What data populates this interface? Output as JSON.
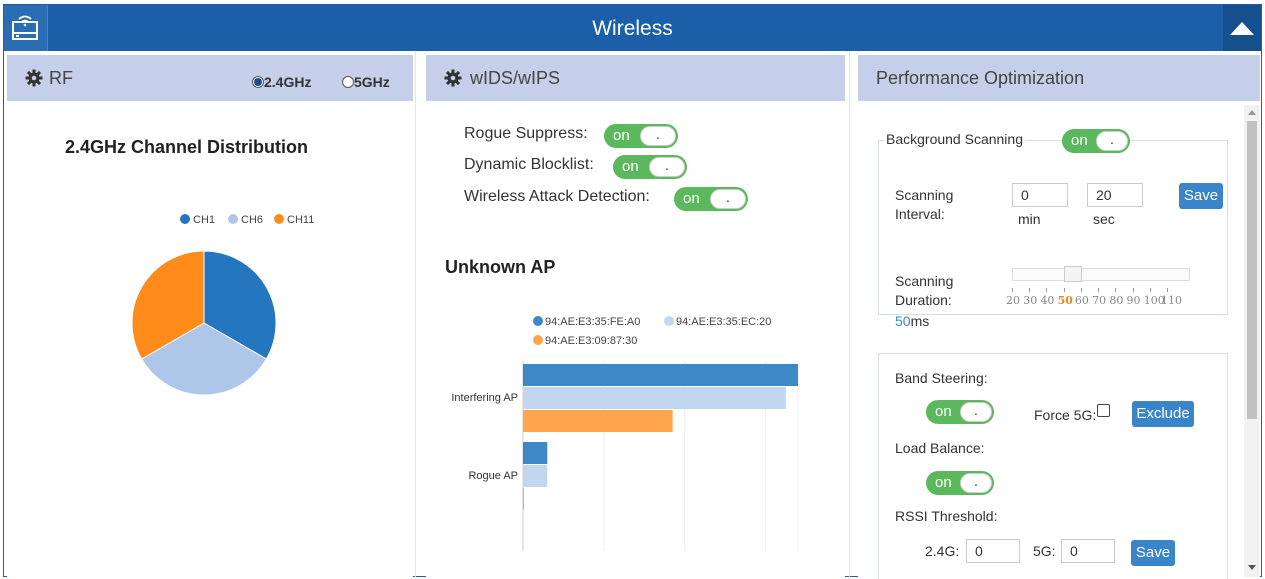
{
  "header": {
    "title": "Wireless",
    "left_icon": "router-icon",
    "right_icon": "caret-up-icon"
  },
  "rf": {
    "title": "RF",
    "band_options": [
      {
        "label": "2.4GHz",
        "selected": true
      },
      {
        "label": "5GHz",
        "selected": false
      }
    ],
    "chart_title": "2.4GHz Channel Distribution"
  },
  "wids": {
    "title": "wIDS/wIPS",
    "toggles": [
      {
        "label": "Rogue Suppress:",
        "state": "on",
        "knob": "."
      },
      {
        "label": "Dynamic Blocklist:",
        "state": "on",
        "knob": "."
      },
      {
        "label": "Wireless Attack Detection:",
        "state": "on",
        "knob": "."
      }
    ],
    "unknown_ap_title": "Unknown AP"
  },
  "perf": {
    "title": "Performance Optimization",
    "background_scanning": {
      "label": "Background Scanning",
      "state": "on",
      "knob": "."
    },
    "scanning_interval": {
      "label_line1": "Scanning",
      "label_line2": "Interval:",
      "min_value": "0",
      "min_unit": "min",
      "sec_value": "20",
      "sec_unit": "sec",
      "save": "Save"
    },
    "scanning_duration": {
      "label_line1": "Scanning",
      "label_line2": "Duration:",
      "value": "50",
      "unit": "ms",
      "level": 0.333,
      "ticks": [
        "20",
        "30",
        "40",
        "50",
        "60",
        "70",
        "80",
        "90",
        "100",
        "110"
      ],
      "selected_tick": "50"
    },
    "band_steering": {
      "label": "Band Steering:",
      "state": "on",
      "knob": ".",
      "force5g_label": "Force 5G:",
      "force5g_checked": false,
      "exclude": "Exclude"
    },
    "load_balance": {
      "label": "Load Balance:",
      "state": "on",
      "knob": "."
    },
    "rssi": {
      "label": "RSSI Threshold:",
      "g24_label": "2.4G:",
      "g24_value": "0",
      "g5_label": "5G:",
      "g5_value": "0",
      "save": "Save"
    }
  },
  "colors": {
    "header": "#1a5fa8",
    "panel_head": "#c5cfe9",
    "toggle_on": "#5cb85c",
    "button": "#3a85c9",
    "ch1": "#2477be",
    "ch6": "#aec7e8",
    "ch11": "#ff8c1a"
  },
  "chart_data": [
    {
      "type": "pie",
      "title": "2.4GHz Channel Distribution",
      "legend_position": "top",
      "categories": [
        "CH1",
        "CH6",
        "CH11"
      ],
      "values": [
        1,
        1,
        1
      ],
      "colors": [
        "#2477be",
        "#aec7e8",
        "#ff8c1a"
      ]
    },
    {
      "type": "bar",
      "orientation": "horizontal",
      "title": "Unknown AP",
      "legend_position": "top",
      "categories": [
        "Interfering AP",
        "Rogue AP"
      ],
      "series": [
        {
          "name": "94:AE:E3:35:FE:A0",
          "values": [
            68,
            6
          ],
          "color": "#3d88c6"
        },
        {
          "name": "94:AE:E3:35:EC:20",
          "values": [
            65,
            6
          ],
          "color": "#c3d6f0"
        },
        {
          "name": "94:AE:E3:09:87:30",
          "values": [
            37,
            0
          ],
          "color": "#ffa64d"
        }
      ],
      "xlim": [
        0,
        68
      ],
      "x_ticks": [
        "0",
        "20",
        "40",
        "60",
        "68"
      ]
    }
  ]
}
